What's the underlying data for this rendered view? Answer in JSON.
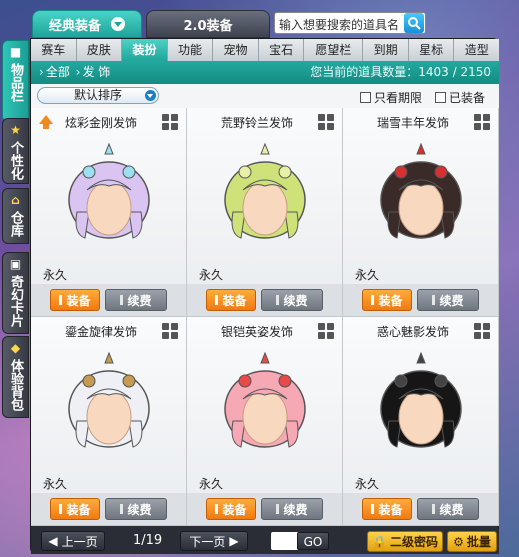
{
  "top_tabs": {
    "classic": "经典装备",
    "v2": "2.0装备"
  },
  "search": {
    "placeholder": "输入想要搜索的道具名"
  },
  "side_tabs": [
    {
      "label": "物品栏",
      "icon": "box-icon"
    },
    {
      "label": "个性化",
      "icon": "star-icon"
    },
    {
      "label": "仓库",
      "icon": "home-icon"
    },
    {
      "label": "奇幻卡片",
      "icon": "card-icon"
    },
    {
      "label": "体验背包",
      "icon": "bag-icon"
    }
  ],
  "category_tabs": [
    "赛车",
    "皮肤",
    "装扮",
    "功能",
    "宠物",
    "宝石",
    "愿望栏",
    "到期",
    "星标",
    "造型"
  ],
  "active_category": "装扮",
  "breadcrumb": {
    "all": "全部",
    "sub": "发 饰"
  },
  "item_count": "您当前的道具数量：1403 / 2150",
  "filters": {
    "sort": "默认排序",
    "expiring_only": "只看期限",
    "equipped": "已装备"
  },
  "items": [
    {
      "name": "炫彩金刚发饰",
      "duration": "永久",
      "equip": "装备",
      "renew": "续费",
      "new": true,
      "hair": "#d9c4f2",
      "accent": "#9bdff0"
    },
    {
      "name": "荒野铃兰发饰",
      "duration": "永久",
      "equip": "装备",
      "renew": "续费",
      "new": false,
      "hair": "#cfe27a",
      "accent": "#e8f0a8"
    },
    {
      "name": "瑞雪丰年发饰",
      "duration": "永久",
      "equip": "装备",
      "renew": "续费",
      "new": false,
      "hair": "#3a2a28",
      "accent": "#d63030"
    },
    {
      "name": "鎏金旋律发饰",
      "duration": "永久",
      "equip": "装备",
      "renew": "续费",
      "new": false,
      "hair": "#eef0f6",
      "accent": "#c59a55"
    },
    {
      "name": "银铠英姿发饰",
      "duration": "永久",
      "equip": "装备",
      "renew": "续费",
      "new": false,
      "hair": "#f6a8b5",
      "accent": "#e84a4a"
    },
    {
      "name": "惑心魅影发饰",
      "duration": "永久",
      "equip": "装备",
      "renew": "续费",
      "new": false,
      "hair": "#161616",
      "accent": "#444444"
    }
  ],
  "pager": {
    "prev": "上一页",
    "next": "下一页",
    "page": "1/19",
    "go": "GO",
    "password": "二级密码",
    "batch": "批量"
  }
}
